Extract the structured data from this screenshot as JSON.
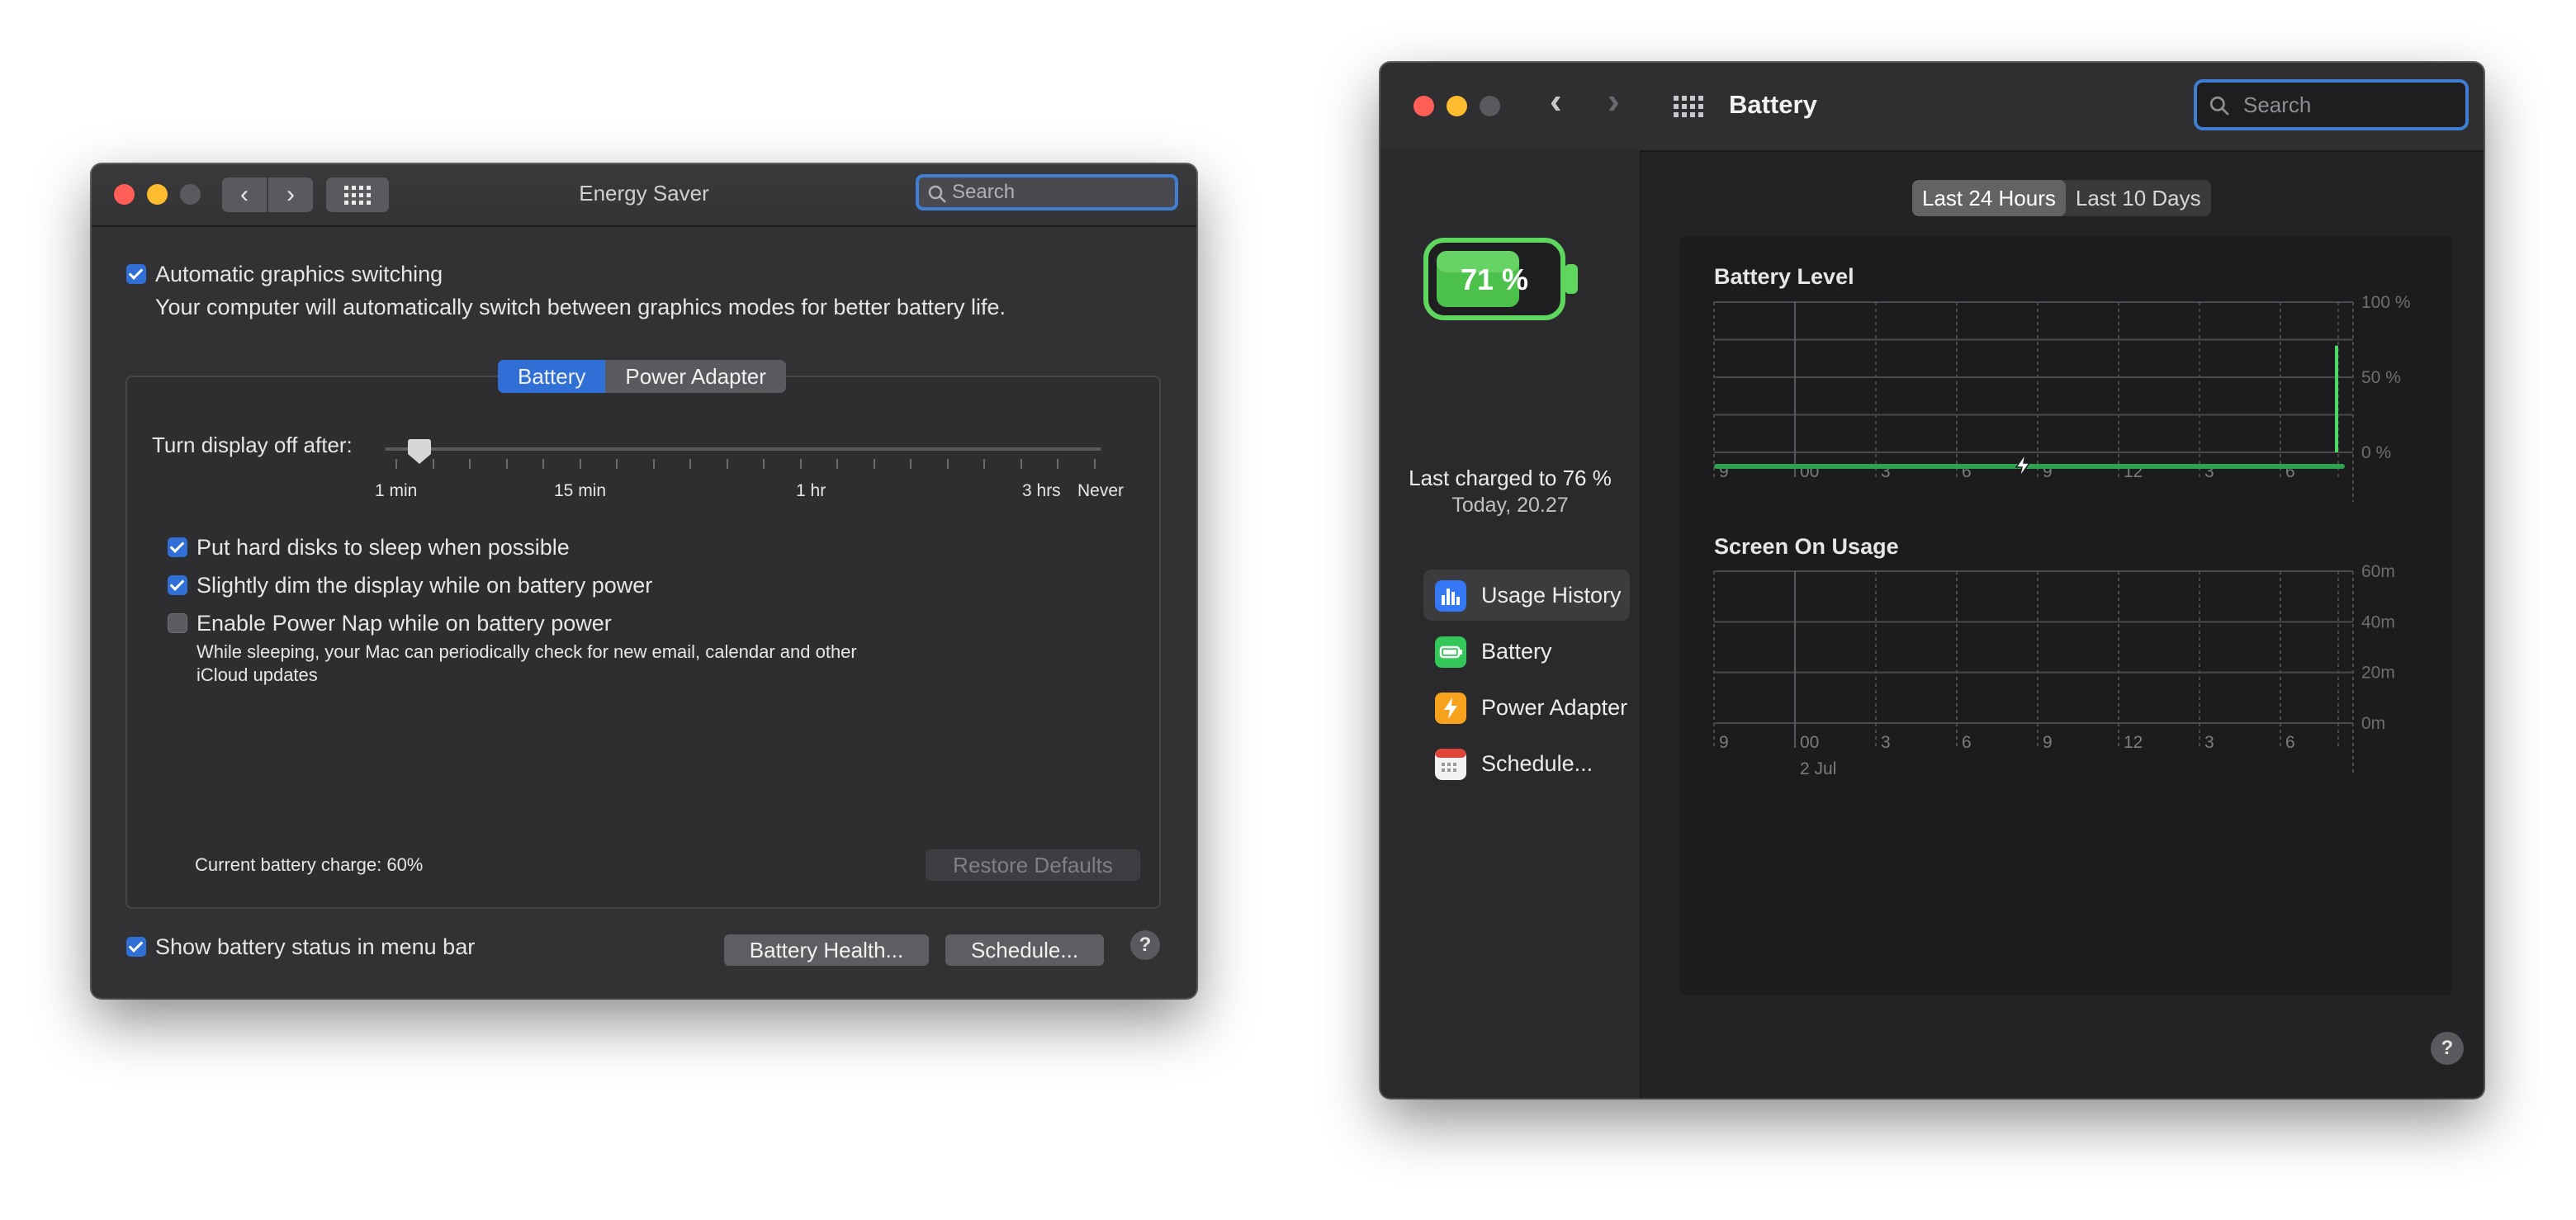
{
  "energy_saver": {
    "title": "Energy Saver",
    "search_placeholder": "Search",
    "auto_graphics": {
      "label": "Automatic graphics switching",
      "description": "Your computer will automatically switch between graphics modes for better battery life.",
      "checked": true
    },
    "tabs": [
      {
        "label": "Battery",
        "selected": true
      },
      {
        "label": "Power Adapter",
        "selected": false
      }
    ],
    "display_off": {
      "label": "Turn display off after:",
      "tick_labels": [
        "1 min",
        "15 min",
        "1 hr",
        "3 hrs",
        "Never"
      ]
    },
    "options": [
      {
        "label": "Put hard disks to sleep when possible",
        "checked": true
      },
      {
        "label": "Slightly dim the display while on battery power",
        "checked": true
      },
      {
        "label": "Enable Power Nap while on battery power",
        "checked": false
      }
    ],
    "power_nap_description_line1": "While sleeping, your Mac can periodically check for new email, calendar and other",
    "power_nap_description_line2": "iCloud updates",
    "battery_charge": "Current battery charge: 60%",
    "restore_defaults": "Restore Defaults",
    "show_status": {
      "label": "Show battery status in menu bar",
      "checked": true
    },
    "battery_health_button": "Battery Health...",
    "schedule_button": "Schedule...",
    "help": "?"
  },
  "battery_window": {
    "title": "Battery",
    "search_placeholder": "Search",
    "battery_percent": "71 %",
    "last_charged": "Last charged to 76 %",
    "last_charged_time": "Today, 20.27",
    "sidebar": [
      {
        "label": "Usage History",
        "icon": "bar-chart-icon",
        "selected": true
      },
      {
        "label": "Battery",
        "icon": "battery-icon",
        "selected": false
      },
      {
        "label": "Power Adapter",
        "icon": "bolt-icon",
        "selected": false
      },
      {
        "label": "Schedule...",
        "icon": "calendar-icon",
        "selected": false
      }
    ],
    "range_tabs": [
      {
        "label": "Last 24 Hours",
        "selected": true
      },
      {
        "label": "Last 10 Days",
        "selected": false
      }
    ],
    "help": "?"
  },
  "chart_data": [
    {
      "type": "bar",
      "title": "Battery Level",
      "categories": [
        "9",
        "00",
        "3",
        "6",
        "9",
        "12",
        "3",
        "6"
      ],
      "y_tick_labels": [
        "100 %",
        "50 %",
        "0 %"
      ],
      "ylim": [
        0,
        100
      ],
      "values": [
        0,
        0,
        0,
        0,
        0,
        0,
        0,
        0,
        71
      ],
      "charging_indicator": "bolt-icon"
    },
    {
      "type": "bar",
      "title": "Screen On Usage",
      "categories": [
        "9",
        "00",
        "3",
        "6",
        "9",
        "12",
        "3",
        "6"
      ],
      "y_tick_labels": [
        "60m",
        "40m",
        "20m",
        "0m"
      ],
      "date_label": "2 Jul",
      "ylim": [
        0,
        60
      ],
      "values": [
        0,
        0,
        0,
        0,
        0,
        0,
        0,
        0
      ]
    }
  ],
  "colors": {
    "accent_blue": "#2f6fd6",
    "battery_green": "#4cd964",
    "charge_line_green": "#30a14e"
  }
}
